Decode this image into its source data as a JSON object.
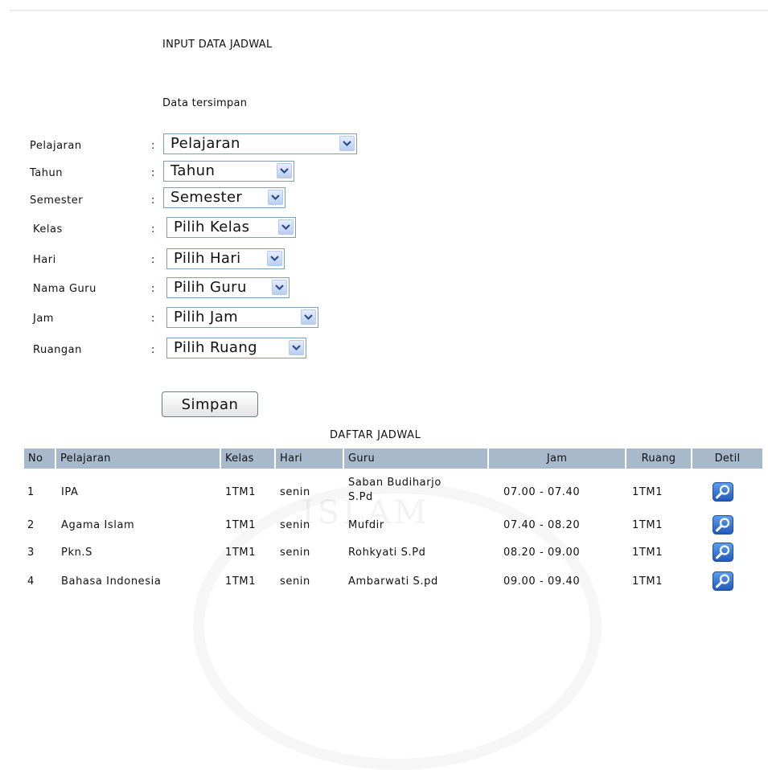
{
  "page": {
    "title": "INPUT DATA JADWAL",
    "status_message": "Data tersimpan"
  },
  "form": {
    "fields": [
      {
        "label": "Pelajaran",
        "colon": ":",
        "selected": "Pelajaran"
      },
      {
        "label": "Tahun",
        "colon": ":",
        "selected": "Tahun"
      },
      {
        "label": "Semester",
        "colon": ":",
        "selected": "Semester"
      },
      {
        "label": "Kelas",
        "colon": ":",
        "selected": "Pilih Kelas"
      },
      {
        "label": "Hari",
        "colon": ":",
        "selected": "Pilih Hari"
      },
      {
        "label": "Nama Guru",
        "colon": ":",
        "selected": "Pilih Guru"
      },
      {
        "label": "Jam",
        "colon": ":",
        "selected": "Pilih Jam"
      },
      {
        "label": "Ruangan",
        "colon": ":",
        "selected": "Pilih Ruang"
      }
    ],
    "submit_label": "Simpan"
  },
  "table": {
    "title": "DAFTAR JADWAL",
    "headers": [
      "No",
      "Pelajaran",
      "Kelas",
      "Hari",
      "Guru",
      "Jam",
      "Ruang",
      "Detil"
    ],
    "rows": [
      {
        "no": "1",
        "pelajaran": "IPA",
        "kelas": "1TM1",
        "hari": "senin",
        "guru_line1": "Saban Budiharjo",
        "guru_line2": "S.Pd",
        "jam": "07.00 - 07.40",
        "ruang": "1TM1",
        "detil_icon": "magnifier-icon"
      },
      {
        "no": "2",
        "pelajaran": "Agama Islam",
        "kelas": "1TM1",
        "hari": "senin",
        "guru_line1": "Mufdir",
        "guru_line2": "",
        "jam": "07.40 - 08.20",
        "ruang": "1TM1",
        "detil_icon": "magnifier-icon"
      },
      {
        "no": "3",
        "pelajaran": "Pkn.S",
        "kelas": "1TM1",
        "hari": "senin",
        "guru_line1": "Rohkyati S.Pd",
        "guru_line2": "",
        "jam": "08.20 - 09.00",
        "ruang": "1TM1",
        "detil_icon": "magnifier-icon"
      },
      {
        "no": "4",
        "pelajaran": "Bahasa Indonesia",
        "kelas": "1TM1",
        "hari": "senin",
        "guru_line1": "Ambarwati S.pd",
        "guru_line2": "",
        "jam": "09.00 - 09.40",
        "ruang": "1TM1",
        "detil_icon": "magnifier-icon"
      }
    ]
  },
  "colors": {
    "header_bg": "#a9b9cc",
    "select_border": "#7f9db9",
    "icon_blue": "#2f6fcf"
  }
}
